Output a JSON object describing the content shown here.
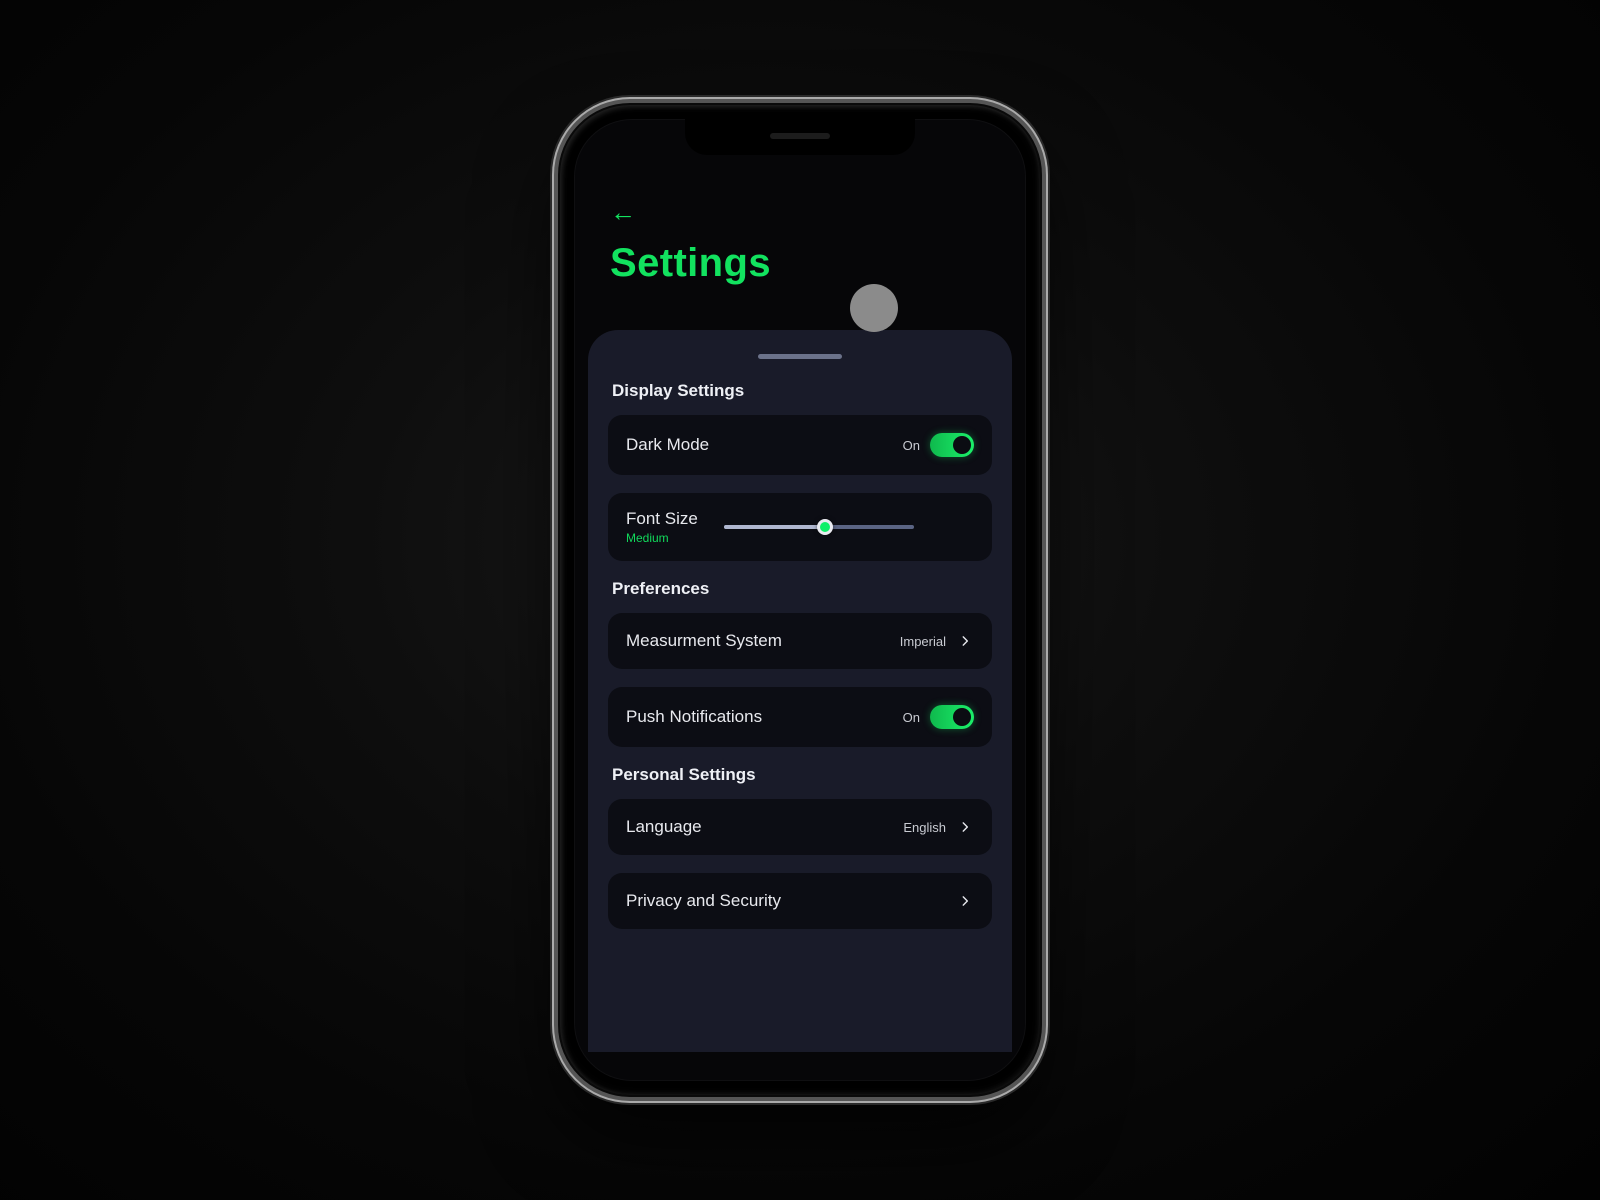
{
  "header": {
    "title": "Settings"
  },
  "sections": {
    "display": {
      "title": "Display Settings",
      "darkMode": {
        "label": "Dark Mode",
        "state": "On"
      },
      "fontSize": {
        "label": "Font Size",
        "value": "Medium"
      }
    },
    "preferences": {
      "title": "Preferences",
      "measurement": {
        "label": "Measurment System",
        "value": "Imperial"
      },
      "push": {
        "label": "Push Notifications",
        "state": "On"
      }
    },
    "personal": {
      "title": "Personal Settings",
      "language": {
        "label": "Language",
        "value": "English"
      },
      "privacy": {
        "label": "Privacy and Security"
      }
    }
  },
  "colors": {
    "accent": "#12e25f",
    "panel": "#191b29",
    "row": "#0c0d14"
  }
}
